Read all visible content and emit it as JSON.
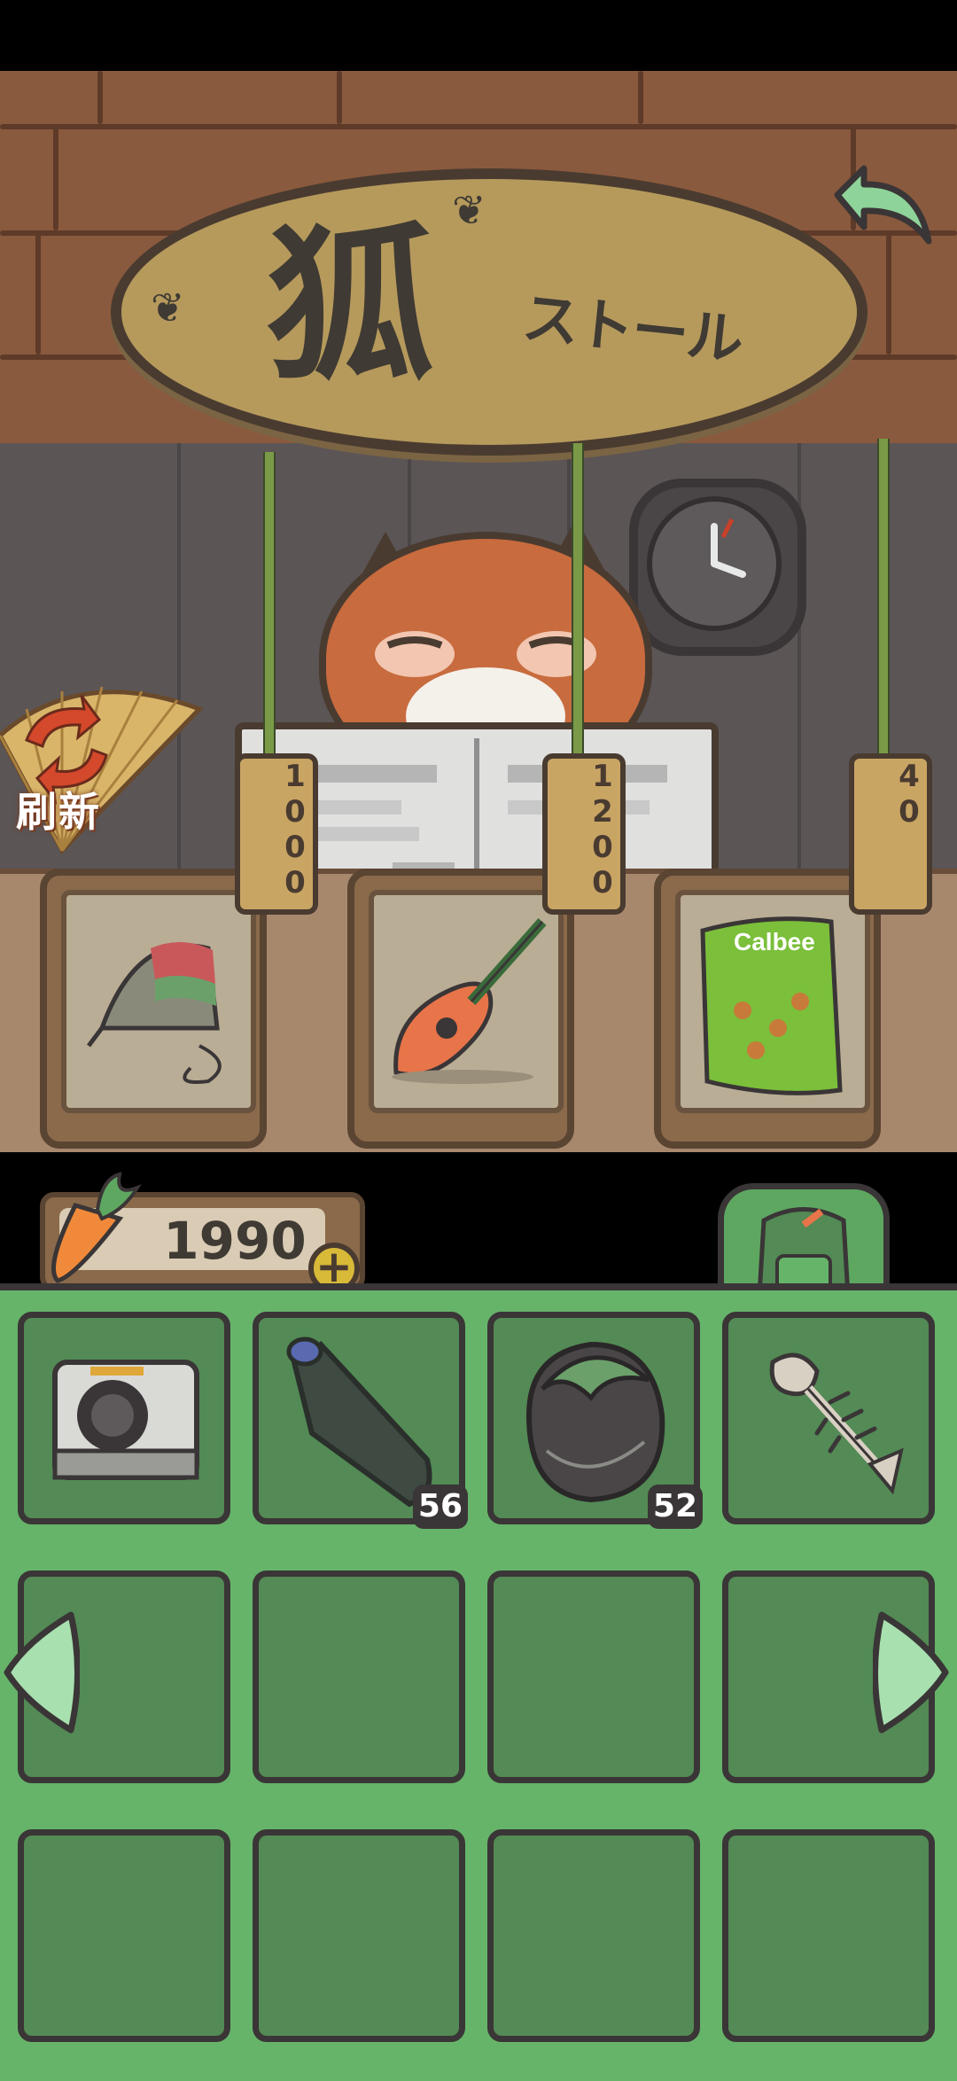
{
  "shop": {
    "sign_title": "狐",
    "sign_subtitle": "ストール",
    "refresh_label": "刷新"
  },
  "shop_items": [
    {
      "name": "Spinning top",
      "icon": "spinning-top-icon",
      "price": "1000"
    },
    {
      "name": "Fish guitar",
      "icon": "fish-guitar-icon",
      "price": "1200"
    },
    {
      "name": "Snack bag",
      "icon": "snack-bag-icon",
      "price": "40"
    }
  ],
  "snack_brand": "Calbee",
  "player": {
    "currency_value": "1990",
    "currency_icon": "carrot-icon"
  },
  "inventory": [
    {
      "icon": "instant-camera-icon",
      "qty": ""
    },
    {
      "icon": "plastic-bottle-icon",
      "qty": "56"
    },
    {
      "icon": "eggplant-junk-icon",
      "qty": "52"
    },
    {
      "icon": "fish-bone-icon",
      "qty": ""
    },
    {
      "icon": "",
      "qty": ""
    },
    {
      "icon": "",
      "qty": ""
    },
    {
      "icon": "",
      "qty": ""
    },
    {
      "icon": "",
      "qty": ""
    },
    {
      "icon": "",
      "qty": ""
    },
    {
      "icon": "",
      "qty": ""
    },
    {
      "icon": "",
      "qty": ""
    },
    {
      "icon": "",
      "qty": ""
    }
  ],
  "colors": {
    "inventory_bg": "#66b46a",
    "slot_bg": "#538a55",
    "roof": "#8a5a3e",
    "sign": "#b69a5c",
    "fox": "#c86b3e"
  }
}
